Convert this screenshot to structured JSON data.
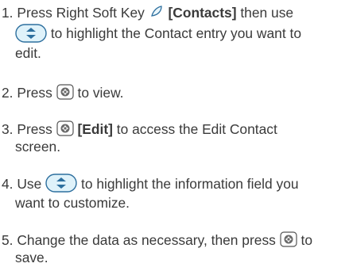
{
  "steps": [
    {
      "number": "1.",
      "line1_a": "Press Right Soft Key",
      "line1_bold": "[Contacts]",
      "line1_b": "then use",
      "line2_a": "to highlight the Contact entry you want to",
      "line3": "edit."
    },
    {
      "number": "2.",
      "text_a": "Press",
      "text_b": "to view."
    },
    {
      "number": "3.",
      "text_a": "Press",
      "bold": "[Edit]",
      "text_b": "to access the Edit Contact",
      "line2": "screen."
    },
    {
      "number": "4.",
      "text_a": "Use",
      "text_b": "to highlight the information field you",
      "line2": "want to customize."
    },
    {
      "number": "5.",
      "text_a": "Change the data as necessary, then press",
      "text_b": "to",
      "line2": "save."
    }
  ],
  "icons": {
    "soft_key": "right-soft-key-icon",
    "nav": "navigation-key-icon",
    "ok": "ok-key-icon"
  },
  "colors": {
    "text": "#3a3a3a",
    "icon_fill": "#dff2fa",
    "icon_stroke": "#2d6f9e"
  }
}
